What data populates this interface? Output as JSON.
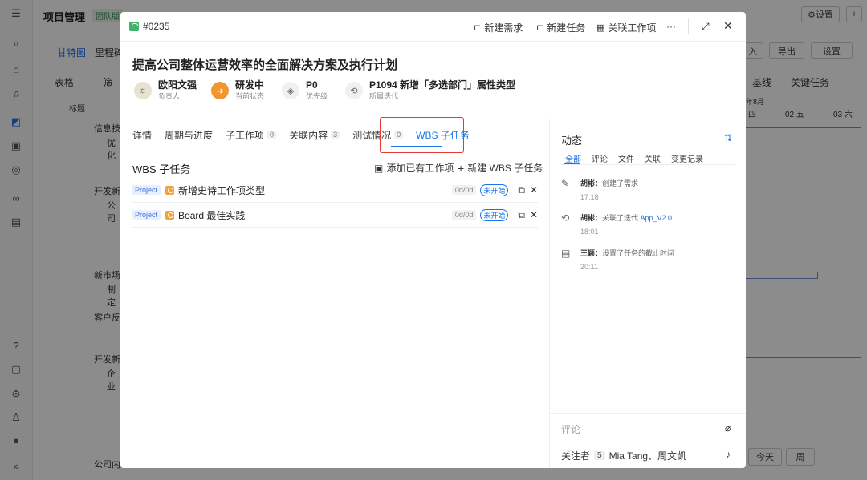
{
  "background": {
    "project_title": "项目管理",
    "team_badge": "团队版",
    "settings_btn": "设置",
    "tabs": [
      "甘特图",
      "里程碑"
    ],
    "toolbar": {
      "table": "表格",
      "filter": "筛",
      "import": "入",
      "export": "导出",
      "settings": "设置",
      "baseline": "基线",
      "critical": "关键任务"
    },
    "grid_header": {
      "title_col": "标题",
      "month": "年8月",
      "days": [
        "四",
        "02 五",
        "03 六"
      ]
    },
    "rows": [
      "信息技",
      "优化",
      "",
      "开发新",
      "公司",
      "",
      "",
      "新市场",
      "制定",
      "客户反",
      "",
      "开发新",
      "企业",
      "",
      "",
      "公司内"
    ],
    "bottom": {
      "today": "今天",
      "week": "周"
    }
  },
  "modal": {
    "id": "#0235",
    "actions": {
      "new_req": "新建需求",
      "new_task": "新建任务",
      "link_item": "关联工作项",
      "more": "···"
    },
    "title": "提高公司整体运营效率的全面解决方案及执行计划",
    "meta": [
      {
        "value": "欧阳文强",
        "label": "负责人"
      },
      {
        "value": "研发中",
        "label": "当前状态"
      },
      {
        "value": "P0",
        "label": "优先级"
      },
      {
        "value": "P1094 新增「多选部门」属性类型",
        "label": "所属迭代"
      }
    ],
    "tabs": [
      {
        "label": "详情",
        "count": ""
      },
      {
        "label": "周期与进度",
        "count": ""
      },
      {
        "label": "子工作项",
        "count": "0"
      },
      {
        "label": "关联内容",
        "count": "3"
      },
      {
        "label": "测试情况",
        "count": "0"
      },
      {
        "label": "WBS 子任务",
        "count": ""
      }
    ],
    "wbs": {
      "title": "WBS 子任务",
      "add_existing": "添加已有工作项",
      "new_sub": "新建 WBS 子任务",
      "items": [
        {
          "tag": "Project",
          "name": "新增史诗工作项类型",
          "duration": "0d/0d",
          "status": "未开始"
        },
        {
          "tag": "Project",
          "name": "Board 最佳实践",
          "duration": "0d/0d",
          "status": "未开始"
        }
      ]
    },
    "activity": {
      "title": "动态",
      "subtabs": [
        "全部",
        "评论",
        "文件",
        "关联",
        "变更记录"
      ],
      "logs": [
        {
          "user": "胡彬：",
          "text": "创建了需求",
          "link": "",
          "time": "17:18"
        },
        {
          "user": "胡彬：",
          "text": "关联了迭代 ",
          "link": "App_V2.0",
          "time": "18:01"
        },
        {
          "user": "王颖：",
          "text": "设置了任务的截止时间",
          "link": "",
          "time": "20:11"
        }
      ],
      "comment_placeholder": "评论",
      "followers_label": "关注者",
      "followers_count": "5",
      "followers": "Mia Tang、周文凯"
    }
  }
}
